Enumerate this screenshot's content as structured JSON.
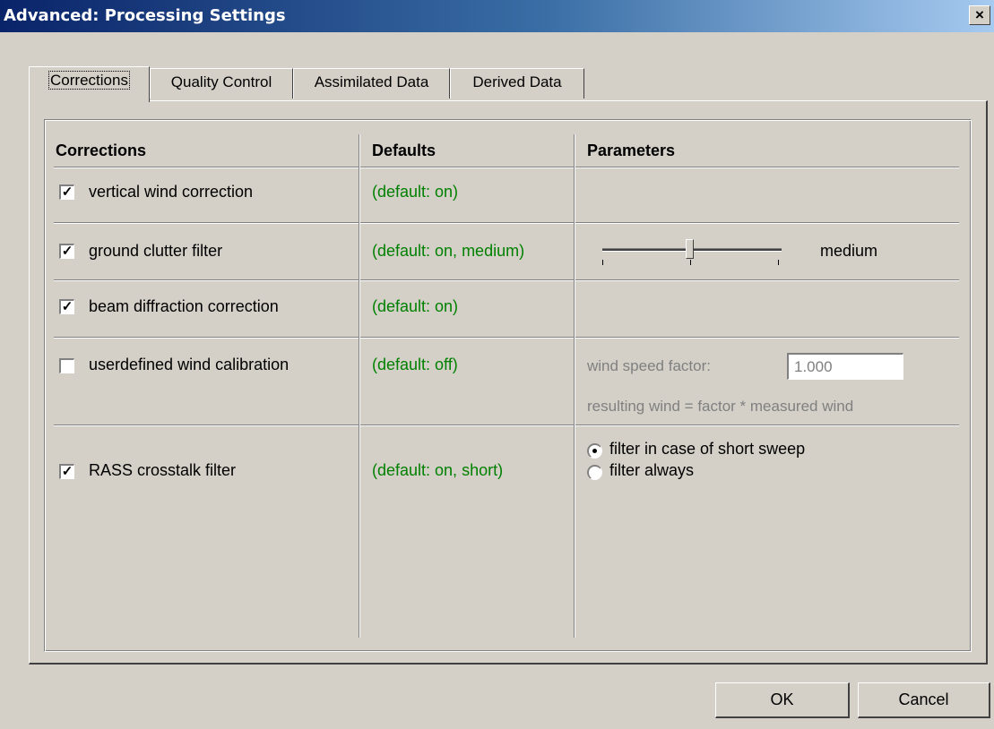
{
  "window": {
    "title": "Advanced: Processing Settings",
    "close_glyph": "×"
  },
  "tabs": [
    {
      "label": "Corrections",
      "active": true
    },
    {
      "label": "Quality Control",
      "active": false
    },
    {
      "label": "Assimilated Data",
      "active": false
    },
    {
      "label": "Derived Data",
      "active": false
    }
  ],
  "table": {
    "headers": {
      "corrections": "Corrections",
      "defaults": "Defaults",
      "parameters": "Parameters"
    },
    "rows": [
      {
        "label": "vertical wind correction",
        "checked": true,
        "default": "(default: on)"
      },
      {
        "label": "ground clutter filter",
        "checked": true,
        "default": "(default: on, medium)",
        "slider_value": "medium",
        "slider_level": 0.5
      },
      {
        "label": "beam diffraction correction",
        "checked": true,
        "default": "(default: on)"
      },
      {
        "label": "userdefined wind calibration",
        "checked": false,
        "default": "(default: off)",
        "param_label": "wind speed factor:",
        "param_value": "1.000",
        "param_note": "resulting wind = factor * measured wind"
      },
      {
        "label": "RASS crosstalk filter",
        "checked": true,
        "default": "(default: on, short)",
        "options": [
          {
            "label": "filter in case of short sweep",
            "selected": true
          },
          {
            "label": "filter always",
            "selected": false
          }
        ]
      }
    ]
  },
  "buttons": {
    "ok": "OK",
    "cancel": "Cancel"
  },
  "colors": {
    "default_text": "#008000",
    "disabled_text": "#808080",
    "face": "#d4d0c8"
  }
}
